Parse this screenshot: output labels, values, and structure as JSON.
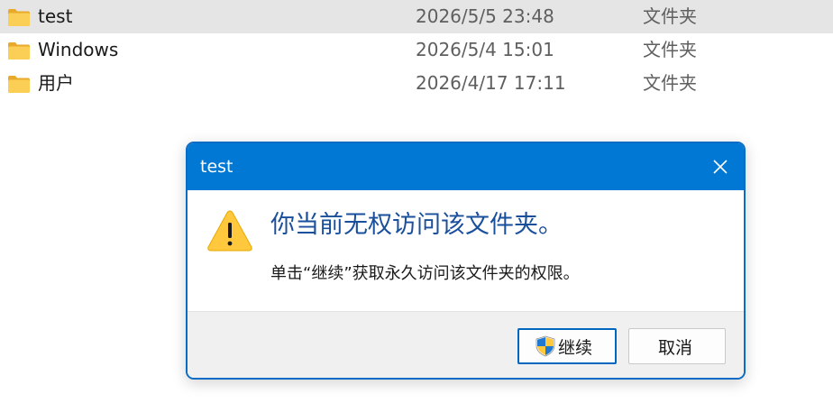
{
  "files": [
    {
      "name": "test",
      "date": "2026/5/5 23:48",
      "type": "文件夹",
      "selected": true
    },
    {
      "name": "Windows",
      "date": "2026/5/4 15:01",
      "type": "文件夹",
      "selected": false
    },
    {
      "name": "用户",
      "date": "2026/4/17 17:11",
      "type": "文件夹",
      "selected": false
    }
  ],
  "dialog": {
    "title": "test",
    "heading": "你当前无权访问该文件夹。",
    "message": "单击“继续”获取永久访问该文件夹的权限。",
    "continue_label": "继续",
    "cancel_label": "取消",
    "icons": {
      "close": "close-icon",
      "warning": "warning-icon",
      "shield": "shield-icon"
    }
  },
  "colors": {
    "titlebar": "#0078d4",
    "heading": "#1a4f9c",
    "selected_row": "#e5e5e5",
    "folder": "#f8c94a"
  }
}
